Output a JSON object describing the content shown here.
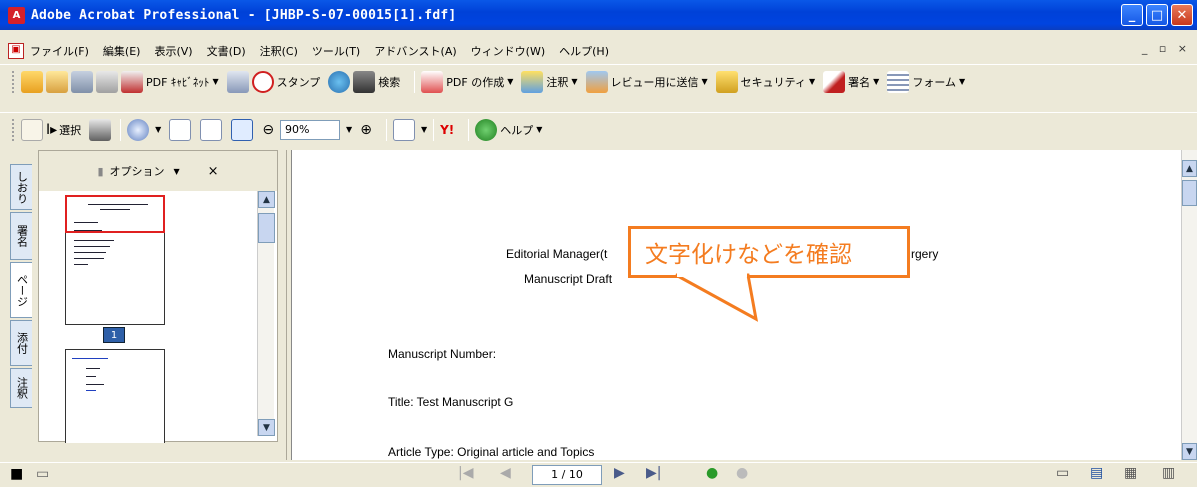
{
  "window": {
    "title": "Adobe Acrobat Professional - [JHBP-S-07-00015[1].fdf]",
    "controls": [
      "_",
      "□",
      "✕"
    ]
  },
  "menu": {
    "items": [
      "ファイル(F)",
      "編集(E)",
      "表示(V)",
      "文書(D)",
      "注釈(C)",
      "ツール(T)",
      "アドバンスト(A)",
      "ウィンドウ(W)",
      "ヘルプ(H)"
    ],
    "right_controls": "_ ▫ ×"
  },
  "toolbar1": {
    "pdf_cabinet": "PDF ｷｬﾋﾞﾈｯﾄ",
    "stamp": "スタンプ",
    "search": "検索",
    "create_pdf": "PDF の作成",
    "comment": "注釈",
    "send_review": "レビュー用に送信",
    "security": "セキュリティ",
    "sign": "署名",
    "form": "フォーム"
  },
  "toolbar2": {
    "select": "選択",
    "zoom_value": "90%",
    "help": "ヘルプ"
  },
  "left_panel": {
    "options_label": "オプション",
    "close": "×",
    "tabs": [
      "しおり",
      "署名",
      "ページ",
      "添付",
      "注釈"
    ],
    "current_page_thumb": "1"
  },
  "document": {
    "header_line1_left": "Editorial Manager(t",
    "header_line1_right": "rgery",
    "header_line2": "Manuscript Draft",
    "manuscript_number": "Manuscript Number:",
    "title": "Title: Test Manuscript G",
    "article_type": "Article Type: Original article and Topics"
  },
  "callout": {
    "text": "文字化けなどを確認"
  },
  "statusbar": {
    "page_display": "1 / 10"
  },
  "colors": {
    "titlebar": "#0044e0",
    "callout_border": "#f47c20",
    "chrome": "#ece9d8"
  }
}
